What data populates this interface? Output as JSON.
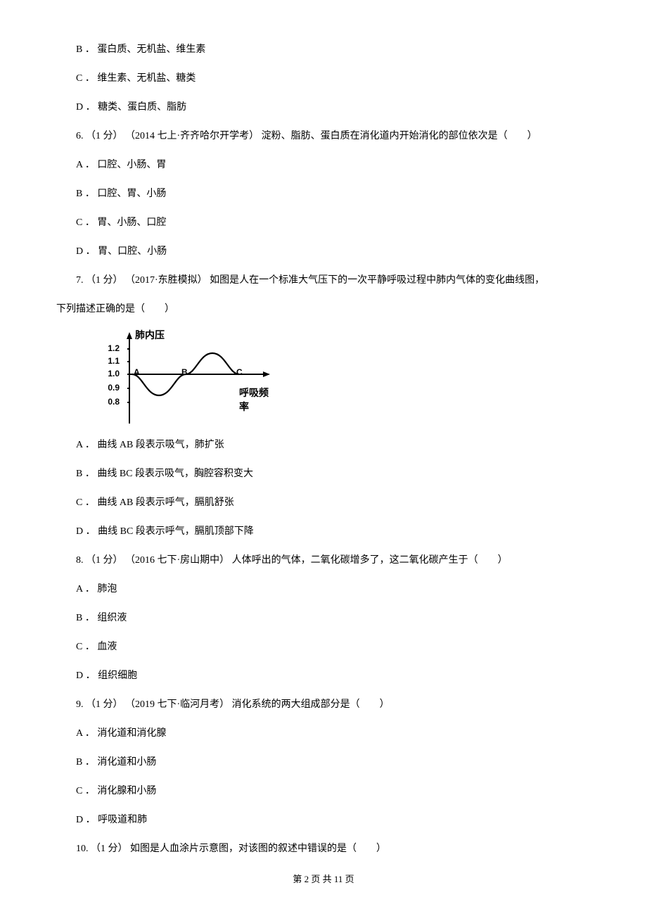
{
  "options_prev": {
    "B": "B ． 蛋白质、无机盐、维生素",
    "C": "C ． 维生素、无机盐、糖类",
    "D": "D ． 糖类、蛋白质、脂肪"
  },
  "q6": {
    "stem": "6.  （1 分） （2014 七上·齐齐哈尔开学考） 淀粉、脂肪、蛋白质在消化道内开始消化的部位依次是（　　）",
    "A": "A ． 口腔、小肠、胃",
    "B": "B ． 口腔、胃、小肠",
    "C": "C ． 胃、小肠、口腔",
    "D": "D ． 胃、口腔、小肠"
  },
  "q7": {
    "stem_line1": "7.  （1 分） （2017·东胜模拟） 如图是人在一个标准大气压下的一次平静呼吸过程中肺内气体的变化曲线图，",
    "stem_line2": "下列描述正确的是（　　）",
    "A": "A ． 曲线 AB 段表示吸气，肺扩张",
    "B": "B ． 曲线 BC 段表示吸气，胸腔容积变大",
    "C": "C ． 曲线 AB 段表示呼气，膈肌舒张",
    "D": "D ． 曲线 BC 段表示呼气，膈肌顶部下降"
  },
  "q8": {
    "stem": "8.  （1 分） （2016 七下·房山期中） 人体呼出的气体，二氧化碳增多了，这二氧化碳产生于（　　）",
    "A": "A ． 肺泡",
    "B": "B ． 组织液",
    "C": "C ． 血液",
    "D": "D ． 组织细胞"
  },
  "q9": {
    "stem": "9.  （1 分） （2019 七下·临河月考） 消化系统的两大组成部分是（　　）",
    "A": "A ． 消化道和消化腺",
    "B": "B ． 消化道和小肠",
    "C": "C ． 消化腺和小肠",
    "D": "D ． 呼吸道和肺"
  },
  "q10": {
    "stem": "10.  （1 分）  如图是人血涂片示意图，对该图的叙述中错误的是（　　）"
  },
  "chart": {
    "yAxisLabel": "肺内压",
    "xAxisLabel": "呼吸频率",
    "ticks": {
      "t12": "1.2",
      "t11": "1.1",
      "t10": "1.0",
      "t09": "0.9",
      "t08": "0.8"
    },
    "points": {
      "A": "A",
      "B": "B",
      "C": "C"
    }
  },
  "chart_data": {
    "type": "line",
    "title": "",
    "xlabel": "呼吸频率",
    "ylabel": "肺内压",
    "ylim": [
      0.8,
      1.2
    ],
    "y_ticks": [
      0.8,
      0.9,
      1.0,
      1.1,
      1.2
    ],
    "series": [
      {
        "name": "肺内压",
        "points": [
          {
            "label": "A",
            "x": 0,
            "y": 1.0
          },
          {
            "label": "",
            "x": 1,
            "y": 0.85
          },
          {
            "label": "B",
            "x": 2,
            "y": 1.0
          },
          {
            "label": "",
            "x": 3,
            "y": 1.15
          },
          {
            "label": "C",
            "x": 4,
            "y": 1.0
          }
        ]
      }
    ]
  },
  "footer": "第 2 页 共 11 页"
}
